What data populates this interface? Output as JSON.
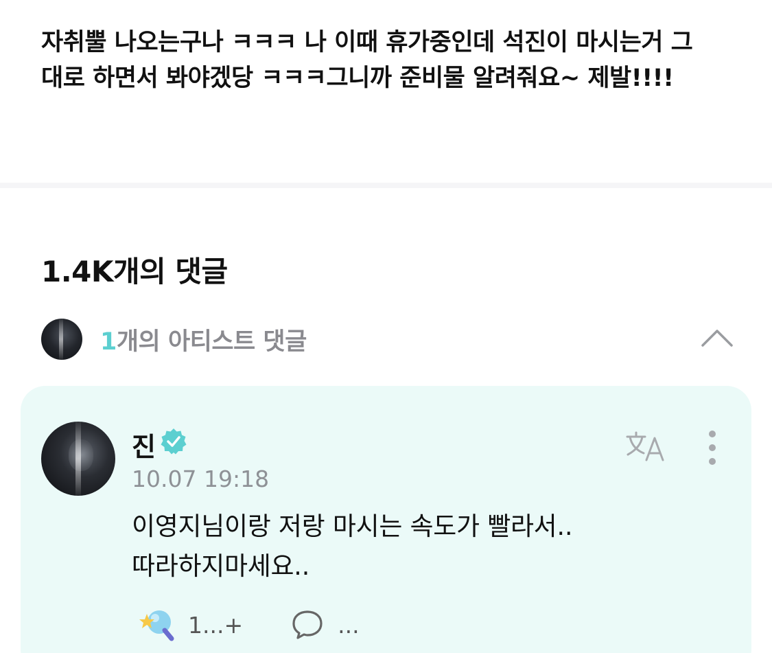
{
  "post": {
    "body_lines": [
      "자취뿔 나오는구나 ㅋㅋㅋ 나 이때 휴가중인데 석진이 마시는거 그",
      "대로 하면서 봐야겠당 ㅋㅋㅋ그니까 준비물 알려줘요~ 제발!!!!"
    ]
  },
  "comments": {
    "title": "1.4K개의 댓글",
    "artist_section": {
      "count": "1",
      "label": "개의 아티스트 댓글",
      "collapse_icon": "chevron-up-icon"
    }
  },
  "artist_comment": {
    "author": "진",
    "verified_icon": "verified-badge-icon",
    "timestamp": "10.07 19:18",
    "text_lines": [
      "이영지님이랑 저랑 마시는 속도가 빨라서..",
      "따라하지마세요.."
    ],
    "reaction_count": "1...+",
    "reply_count": "...",
    "translate_icon": "translate-icon",
    "more_icon": "more-vertical-icon"
  },
  "colors": {
    "accent": "#5ccfd0",
    "card_background": "#ebfaf8",
    "muted_text": "#8e9196"
  }
}
